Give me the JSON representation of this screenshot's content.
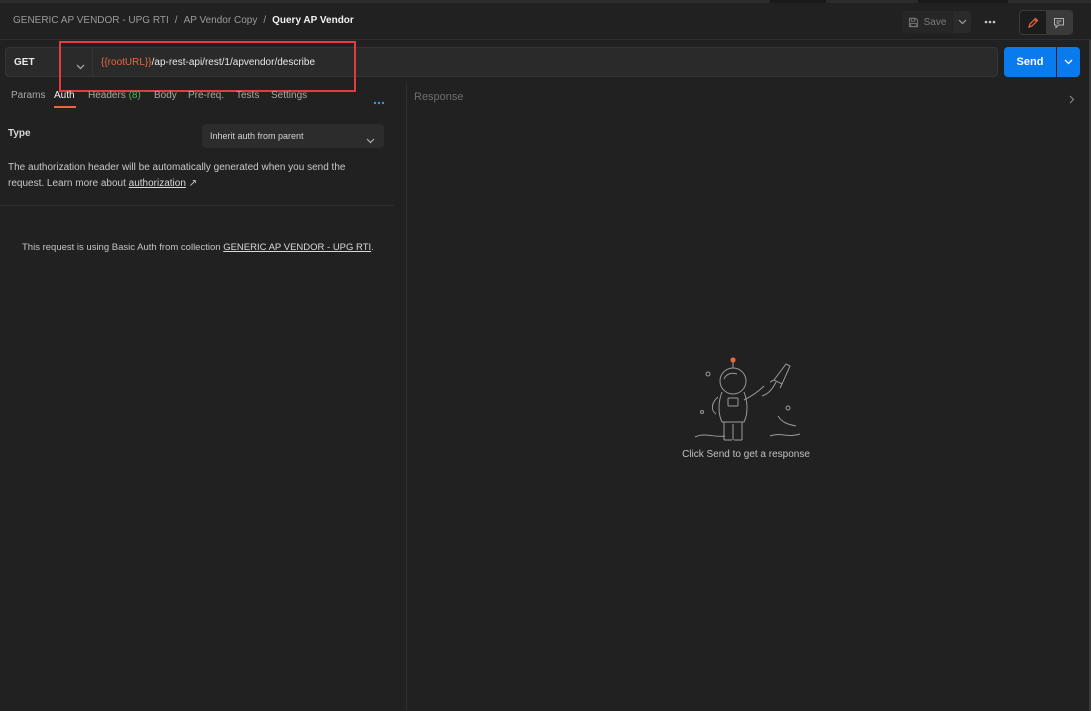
{
  "breadcrumb": {
    "collection": "GENERIC AP VENDOR - UPG RTI",
    "folder": "AP Vendor Copy",
    "current": "Query AP Vendor",
    "separator": "/"
  },
  "toolbar": {
    "save_label": "Save",
    "more_icon": "ellipsis-icon",
    "edit_icon": "pencil-icon",
    "comments_icon": "comment-icon"
  },
  "request": {
    "method": "GET",
    "url_variable": "{{rootURL}}",
    "url_path": "/ap-rest-api/rest/1/apvendor/describe",
    "send_label": "Send"
  },
  "tabs": {
    "params": "Params",
    "auth": "Auth",
    "headers": "Headers",
    "headers_count": "(8)",
    "body": "Body",
    "prereq": "Pre-req.",
    "tests": "Tests",
    "settings": "Settings",
    "active": "Auth"
  },
  "auth": {
    "type_label": "Type",
    "type_value": "Inherit auth from parent",
    "description": "The authorization header will be automatically generated when you send the request. Learn more about",
    "link_text": "authorization",
    "link_arrow": "↗",
    "note_prefix": "This request is using Basic Auth from collection",
    "note_collection": "GENERIC AP VENDOR - UPG RTI",
    "note_suffix": "."
  },
  "response": {
    "label": "Response",
    "hint": "Click Send to get a response",
    "illustration": "astronaut-rocket-illustration"
  },
  "colors": {
    "background": "#212121",
    "accent_orange": "#e6693e",
    "send_blue": "#097bed",
    "highlight_red": "#e03e3e",
    "count_green": "#48b860"
  }
}
